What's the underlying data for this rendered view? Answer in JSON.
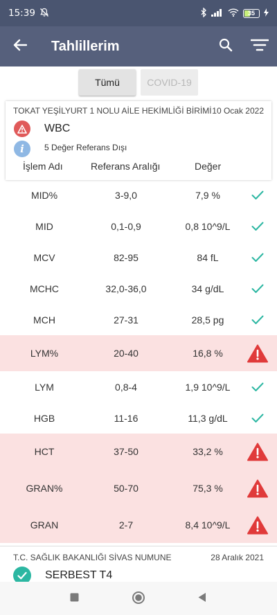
{
  "status_bar": {
    "time": "15:39",
    "battery": "35"
  },
  "app_bar": {
    "title": "Tahlillerim"
  },
  "tabs": [
    {
      "label": "Tümü",
      "selected": true
    },
    {
      "label": "COVID-19",
      "selected": false
    }
  ],
  "report": {
    "institution": "TOKAT YEŞİLYURT 1 NOLU AİLE HEKİMLİĞİ BİRİMİ",
    "date": "10 Ocak 2022",
    "test_name": "WBC",
    "out_of_range_summary": "5 Değer Referans Dışı",
    "columns": {
      "name": "İşlem Adı",
      "reference": "Referans Aralığı",
      "value": "Değer"
    },
    "rows": [
      {
        "name": "MID%",
        "reference": "3-9,0",
        "value": "7,9 %",
        "status": "normal"
      },
      {
        "name": "MID",
        "reference": "0,1-0,9",
        "value": "0,8 10^9/L",
        "status": "normal"
      },
      {
        "name": "MCV",
        "reference": "82-95",
        "value": "84 fL",
        "status": "normal"
      },
      {
        "name": "MCHC",
        "reference": "32,0-36,0",
        "value": "34 g/dL",
        "status": "normal"
      },
      {
        "name": "MCH",
        "reference": "27-31",
        "value": "28,5 pg",
        "status": "normal"
      },
      {
        "name": "LYM%",
        "reference": "20-40",
        "value": "16,8 %",
        "status": "abnormal"
      },
      {
        "name": "LYM",
        "reference": "0,8-4",
        "value": "1,9 10^9/L",
        "status": "normal"
      },
      {
        "name": "HGB",
        "reference": "11-16",
        "value": "11,3 g/dL",
        "status": "normal"
      },
      {
        "name": "HCT",
        "reference": "37-50",
        "value": "33,2 %",
        "status": "abnormal"
      },
      {
        "name": "GRAN%",
        "reference": "50-70",
        "value": "75,3 %",
        "status": "abnormal"
      },
      {
        "name": "GRAN",
        "reference": "2-7",
        "value": "8,4 10^9/L",
        "status": "abnormal"
      }
    ]
  },
  "report2": {
    "institution": "T.C. SAĞLIK BAKANLIĞI SİVAS NUMUNE",
    "date": "28 Aralık 2021",
    "test_name": "SERBEST T4"
  },
  "colors": {
    "app_bar": "#56607c",
    "status_bar": "#4a5570",
    "abnormal_row": "#fbe1e1",
    "alert_red": "#e05a5a",
    "check_teal": "#2cb7a2",
    "info_blue": "#8fb8e4"
  },
  "icons": {
    "back": "arrow-left-icon",
    "search": "search-icon",
    "filter": "filter-icon",
    "normal": "checkmark-icon",
    "abnormal": "warning-triangle-icon"
  }
}
